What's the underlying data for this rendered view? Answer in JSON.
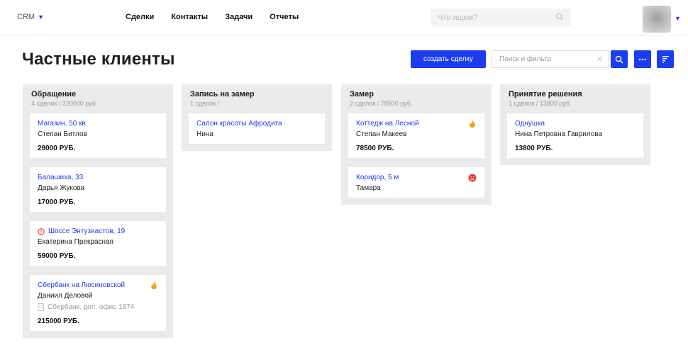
{
  "header": {
    "brand": "CRM",
    "nav": [
      "Сделки",
      "Контакты",
      "Задачи",
      "Отчеты"
    ],
    "search_placeholder": "Что ищем?"
  },
  "page": {
    "title": "Частные клиенты",
    "create_button": "создать сделку",
    "filter_placeholder": "Поиск и фильтр"
  },
  "colors": {
    "accent": "#1a3df0",
    "fire": "#f39c12",
    "alert": "#e53935",
    "column_bg": "#ebebeb"
  },
  "columns": [
    {
      "title": "Обращение",
      "subtitle": "4 сделок / 320000 руб.",
      "cards": [
        {
          "title": "Магазин, 50 кв",
          "person": "Степан Битлов",
          "price": "29000 РУБ."
        },
        {
          "title": "Балашиха, 33",
          "person": "Дарья Жукова",
          "price": "17000 РУБ."
        },
        {
          "title": "Шоссе Энтузиастов, 19",
          "person": "Екатерина Прекрасная",
          "price": "59000 РУБ.",
          "leading_icon": "alert-circle-icon"
        },
        {
          "title": "Сбербанк на Люсиновской",
          "person": "Даниил Деловой",
          "org": "Сбербанк, доп. офис 1874",
          "price": "215000 РУБ.",
          "badge": "fire-icon"
        }
      ]
    },
    {
      "title": "Запись на замер",
      "subtitle": "1 сделок /",
      "cards": [
        {
          "title": "Салон красоты Афродита",
          "person": "Нина"
        }
      ]
    },
    {
      "title": "Замер",
      "subtitle": "2 сделок / 78500 руб.",
      "cards": [
        {
          "title": "Коттедж на Лесной",
          "person": "Степан Макеев",
          "price": "78500 РУБ.",
          "badge": "fire-icon"
        },
        {
          "title": "Коридор, 5 м",
          "person": "Тамара",
          "badge": "sad-face-icon"
        }
      ]
    },
    {
      "title": "Принятие решения",
      "subtitle": "1 сделок / 13800 руб.",
      "cards": [
        {
          "title": "Однушка",
          "person": "Нина Петровна Гаврилова",
          "price": "13800 РУБ."
        }
      ]
    }
  ]
}
